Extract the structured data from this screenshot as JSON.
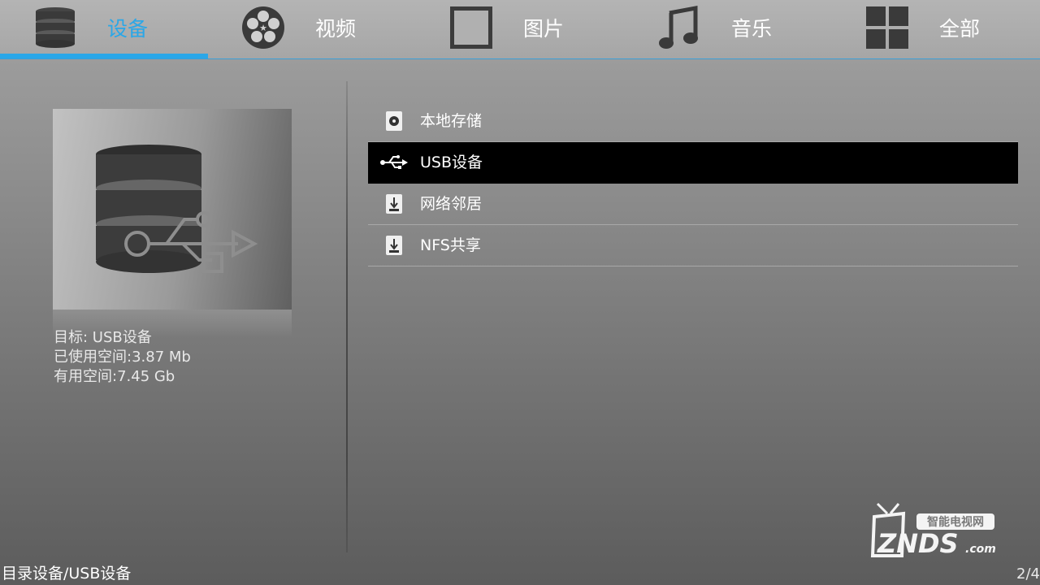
{
  "nav": {
    "tabs": [
      {
        "label": "设备",
        "icon": "database-icon",
        "active": true
      },
      {
        "label": "视频",
        "icon": "film-reel-icon"
      },
      {
        "label": "图片",
        "icon": "picture-frame-icon"
      },
      {
        "label": "音乐",
        "icon": "music-note-icon"
      },
      {
        "label": "全部",
        "icon": "grid-icon"
      }
    ]
  },
  "preview": {
    "icon": "usb-database-icon",
    "target": "目标: USB设备",
    "used": "已使用空间:3.87 Mb",
    "free": "有用空间:7.45 Gb"
  },
  "list": {
    "items": [
      {
        "label": "本地存储",
        "icon": "local-storage-icon"
      },
      {
        "label": "USB设备",
        "icon": "usb-icon",
        "selected": true
      },
      {
        "label": "网络邻居",
        "icon": "network-drive-icon"
      },
      {
        "label": "NFS共享",
        "icon": "network-drive-icon"
      }
    ]
  },
  "footer": {
    "breadcrumb": "目录设备/USB设备",
    "page": "2/4"
  },
  "watermark": {
    "top_text": "智能电视网",
    "brand": "ZNDS",
    "suffix": ".com"
  },
  "colors": {
    "accent": "#2aa7e8",
    "selected_row": "#000000"
  }
}
